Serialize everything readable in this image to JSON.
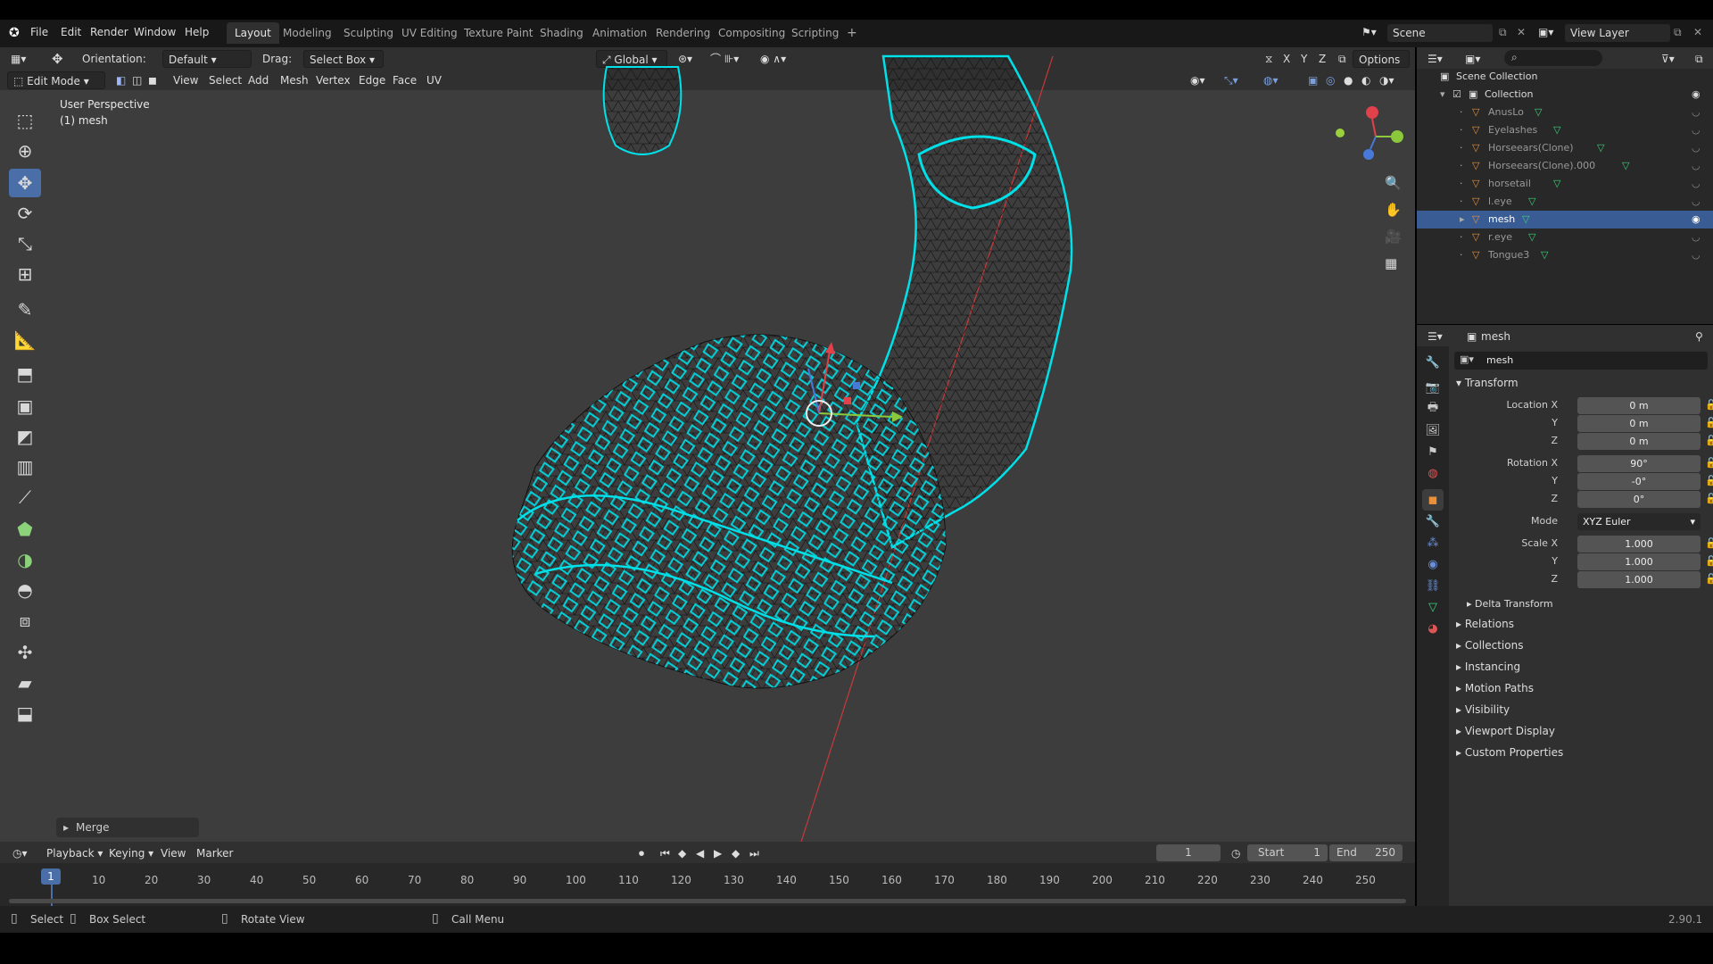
{
  "topbar": {
    "menus": [
      "File",
      "Edit",
      "Render",
      "Window",
      "Help"
    ],
    "workspaces": [
      "Layout",
      "Modeling",
      "Sculpting",
      "UV Editing",
      "Texture Paint",
      "Shading",
      "Animation",
      "Rendering",
      "Compositing",
      "Scripting"
    ],
    "active_workspace": "Layout",
    "scene": "Scene",
    "view_layer": "View Layer"
  },
  "viewport": {
    "orientation_label": "Orientation:",
    "orientation_value": "Default",
    "drag_label": "Drag:",
    "drag_value": "Select Box",
    "transform_orientation": "Global",
    "options_label": "Options",
    "axes": [
      "X",
      "Y",
      "Z"
    ],
    "mode": "Edit Mode",
    "menus": [
      "View",
      "Select",
      "Add",
      "Mesh",
      "Vertex",
      "Edge",
      "Face",
      "UV"
    ],
    "perspective_text": "User Perspective",
    "object_text": "(1) mesh",
    "last_op": "Merge",
    "accent_color": "#00e0e8",
    "tools": [
      "select-box",
      "cursor",
      "move",
      "rotate",
      "scale",
      "transform",
      "annotate",
      "measure",
      "extrude",
      "inset",
      "bevel",
      "loop-cut",
      "knife",
      "poly-build",
      "spin",
      "smooth",
      "edge-slide",
      "shrink-fatten",
      "shear",
      "rip"
    ],
    "active_tool": "move"
  },
  "outliner": {
    "root": "Scene Collection",
    "collection": "Collection",
    "items": [
      {
        "name": "AnusLo",
        "selected": false
      },
      {
        "name": "Eyelashes",
        "selected": false
      },
      {
        "name": "Horseears(Clone)",
        "selected": false
      },
      {
        "name": "Horseears(Clone).000",
        "selected": false
      },
      {
        "name": "horsetail",
        "selected": false
      },
      {
        "name": "l.eye",
        "selected": false
      },
      {
        "name": "mesh",
        "selected": true
      },
      {
        "name": "r.eye",
        "selected": false
      },
      {
        "name": "Tongue3",
        "selected": false
      }
    ]
  },
  "properties": {
    "object_name": "mesh",
    "object_field": "mesh",
    "section": "Transform",
    "location_label": "Location X",
    "rotation_label": "Rotation X",
    "scale_label": "Scale X",
    "y_label": "Y",
    "z_label": "Z",
    "mode_label": "Mode",
    "location": [
      "0 m",
      "0 m",
      "0 m"
    ],
    "rotation": [
      "90°",
      "-0°",
      "0°"
    ],
    "rotation_mode": "XYZ Euler",
    "scale": [
      "1.000",
      "1.000",
      "1.000"
    ],
    "delta": "Delta Transform",
    "panels": [
      "Relations",
      "Collections",
      "Instancing",
      "Motion Paths",
      "Visibility",
      "Viewport Display",
      "Custom Properties"
    ]
  },
  "timeline": {
    "menus": [
      "Playback",
      "Keying",
      "View",
      "Marker"
    ],
    "current_frame": "1",
    "start_label": "Start",
    "start": "1",
    "end_label": "End",
    "end": "250",
    "ticks": [
      "10",
      "20",
      "30",
      "40",
      "50",
      "60",
      "70",
      "80",
      "90",
      "100",
      "110",
      "120",
      "130",
      "140",
      "150",
      "160",
      "170",
      "180",
      "190",
      "200",
      "210",
      "220",
      "230",
      "240",
      "250"
    ]
  },
  "statusbar": {
    "select": "Select",
    "box_select": "Box Select",
    "rotate_view": "Rotate View",
    "call_menu": "Call Menu",
    "version": "2.90.1"
  }
}
